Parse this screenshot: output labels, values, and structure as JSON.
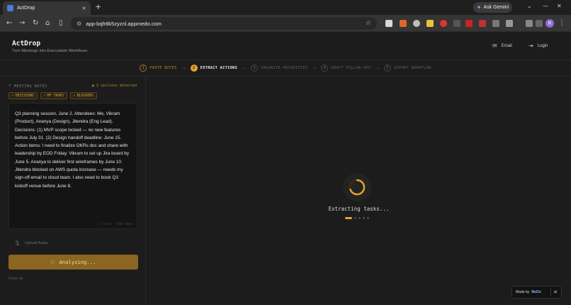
{
  "browser": {
    "tab_title": "ActDrop",
    "tab_close": "×",
    "new_tab": "+",
    "gemini_label": "Ask Gemini",
    "url": "app-bqfr8k5zyznl.appmedo.com",
    "profile_initial": "R"
  },
  "app": {
    "title": "ActDrop",
    "subtitle": "Turn Meetings into Executable Workflows",
    "email_label": "Email",
    "login_label": "Login"
  },
  "steps": [
    {
      "num": "1",
      "label": "PASTE NOTES",
      "state": "done"
    },
    {
      "num": "2",
      "label": "EXTRACT ACTIONS",
      "state": "active"
    },
    {
      "num": "3",
      "label": "ORGANIZE PRIORITIES",
      "state": "todo"
    },
    {
      "num": "4",
      "label": "DRAFT FOLLOW-UPS",
      "state": "todo"
    },
    {
      "num": "5",
      "label": "EXPORT WORKFLOW",
      "state": "todo"
    }
  ],
  "notes": {
    "label": "MEETING NOTES",
    "sections_detected": "3 sections detected",
    "tags": [
      "DECISIONS",
      "MY TASKS",
      "BLOCKERS"
    ],
    "text": "Q3 planning session, June 2. Attendees: Me, Vikram (Product), Ananya (Design), Jitendra (Eng Lead). Decisions: (1) MVP scope locked — no new features before July 31. (2) Design handoff deadline: June 15. Action items: I need to finalize OKRs doc and share with leadership by EOD Friday. Vikram to set up Jira board by June 5. Ananya to deliver first wireframes by June 10. Jitendra blocked on AWS quota increase — needs my sign-off email to cloud team. I also need to book Q3 kickoff venue before June 8.",
    "char_count": "1 lines · 568 chars",
    "upload_label": "Upload Audio",
    "analyze_label": "Analyzing...",
    "clear_label": "Clear all"
  },
  "status": {
    "extracting_label": "Extracting tasks...",
    "progress_step": 1,
    "progress_total": 5
  },
  "badge": {
    "made_by": "Made by",
    "brand": "MeDo",
    "close": "✕"
  },
  "colors": {
    "accent": "#e5a22b",
    "background": "#1c1c1c"
  }
}
